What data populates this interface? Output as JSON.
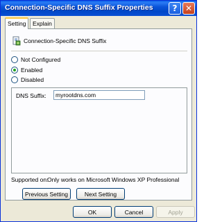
{
  "window": {
    "title": "Connection-Specific DNS Suffix Properties",
    "help_glyph": "?",
    "close_glyph": "✕"
  },
  "tabs": [
    {
      "label": "Setting",
      "active": true
    },
    {
      "label": "Explain",
      "active": false
    }
  ],
  "policy": {
    "name": "Connection-Specific DNS Suffix",
    "icon": "policy-setting-icon"
  },
  "options": [
    {
      "label": "Not Configured",
      "selected": false
    },
    {
      "label": "Enabled",
      "selected": true
    },
    {
      "label": "Disabled",
      "selected": false
    }
  ],
  "dns": {
    "label": "DNS Suffix:",
    "value": "myrootdns.com"
  },
  "supported": {
    "label": "Supported on:",
    "value": "Only works on Microsoft Windows XP Professional"
  },
  "nav": {
    "previous": "Previous Setting",
    "next": "Next Setting"
  },
  "footer": {
    "ok": "OK",
    "cancel": "Cancel",
    "apply": "Apply",
    "apply_enabled": false
  },
  "colors": {
    "titlebar": "#0a54d9",
    "dialog_bg": "#ece9d8",
    "tab_accent": "#ffc83c",
    "radio_selected": "#21a121"
  }
}
